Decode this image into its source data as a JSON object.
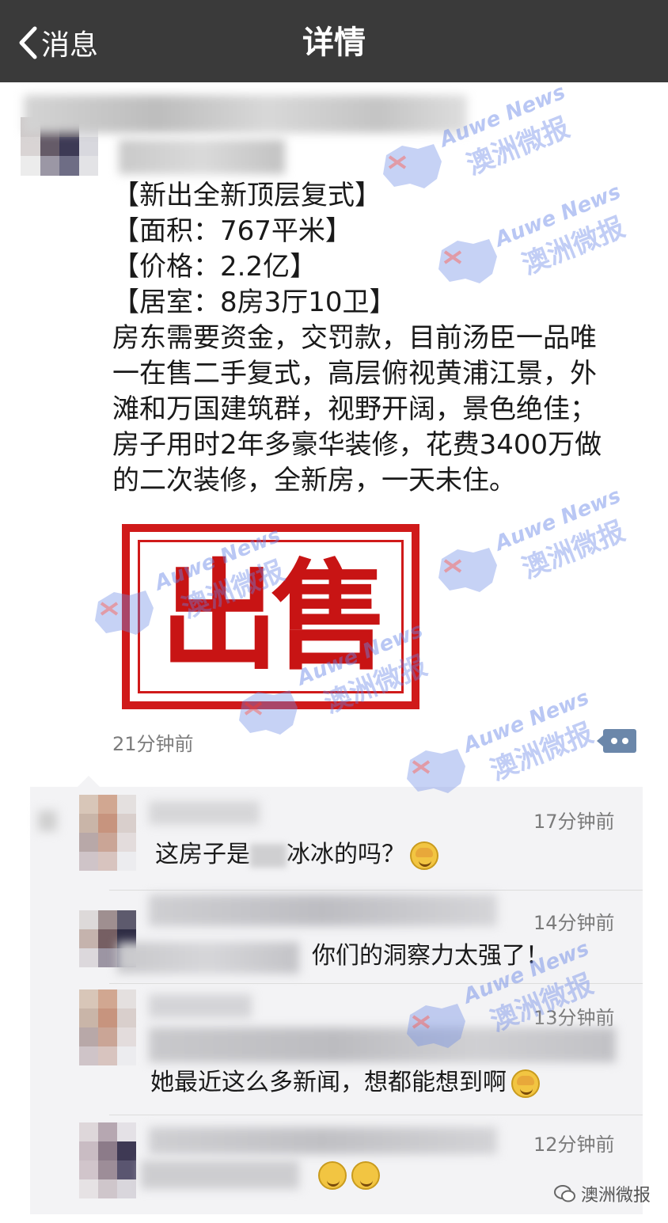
{
  "navbar": {
    "back_label": "消息",
    "title": "详情"
  },
  "post": {
    "lines": [
      "【新出全新顶层复式】",
      "【面积：767平米】",
      "【价格：2.2亿】",
      "【居室：8房3厅10卫】",
      "房东需要资金，交罚款，目前汤臣一品唯",
      "一在售二手复式，高层俯视黄浦江景，外",
      "滩和万国建筑群，视野开阔，景色绝佳；",
      "房子用时2年多豪华装修，花费3400万做",
      "的二次装修，全新房，一天未住。"
    ],
    "stamp_text": "出售",
    "time": "21分钟前"
  },
  "comments": [
    {
      "time": "17分钟前",
      "text": "这房子是",
      "text2": "冰冰的吗？"
    },
    {
      "time": "14分钟前",
      "text": "你们的洞察力太强了！"
    },
    {
      "time": "13分钟前",
      "text": "她最近这么多新闻，想都能想到啊"
    },
    {
      "time": "12分钟前",
      "text": ""
    }
  ],
  "watermark": {
    "en": "Auwe News",
    "cn": "澳洲微报"
  },
  "footer": {
    "brand": "澳洲微报"
  },
  "colors": {
    "navbar": "#3a3a3a",
    "stamp_red": "#d01a1a",
    "comment_bg": "#f3f3f5",
    "watermark": "#6482e6"
  }
}
